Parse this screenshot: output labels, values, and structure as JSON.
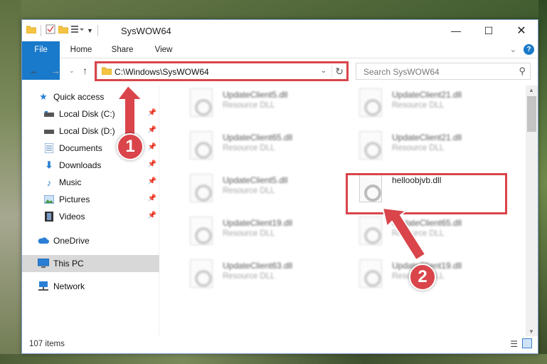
{
  "window": {
    "title": "SysWOW64",
    "controls": {
      "minimize": "—",
      "maximize": "☐",
      "close": "✕"
    }
  },
  "ribbon": {
    "tabs": [
      "File",
      "Home",
      "Share",
      "View"
    ]
  },
  "address": {
    "path": "C:\\Windows\\SysWOW64",
    "search_placeholder": "Search SysWOW64"
  },
  "sidebar": {
    "items": [
      {
        "label": "Quick access",
        "icon": "star-icon",
        "pinned": false
      },
      {
        "label": "Local Disk (C:)",
        "icon": "drive-icon",
        "pinned": true
      },
      {
        "label": "Local Disk (D:)",
        "icon": "drive-icon",
        "pinned": true
      },
      {
        "label": "Documents",
        "icon": "documents-icon",
        "pinned": true
      },
      {
        "label": "Downloads",
        "icon": "download-icon",
        "pinned": true
      },
      {
        "label": "Music",
        "icon": "music-icon",
        "pinned": true
      },
      {
        "label": "Pictures",
        "icon": "pictures-icon",
        "pinned": true
      },
      {
        "label": "Videos",
        "icon": "videos-icon",
        "pinned": true
      },
      {
        "label": "OneDrive",
        "icon": "cloud-icon",
        "pinned": false
      },
      {
        "label": "This PC",
        "icon": "computer-icon",
        "pinned": false,
        "selected": true
      },
      {
        "label": "Network",
        "icon": "network-icon",
        "pinned": false
      }
    ]
  },
  "files": [
    {
      "name": "UpdateClient5.dll",
      "type": "Resource DLL",
      "blurred": true
    },
    {
      "name": "UpdateClient21.dll",
      "type": "Resource DLL",
      "blurred": true
    },
    {
      "name": "UpdateClient65.dll",
      "type": "Resource DLL",
      "blurred": true
    },
    {
      "name": "UpdateClient21.dll",
      "type": "Resource DLL",
      "blurred": true
    },
    {
      "name": "UpdateClient5.dll",
      "type": "Resource DLL",
      "blurred": true
    },
    {
      "name": "helloobjvb.dll",
      "type": "",
      "blurred": false
    },
    {
      "name": "UpdateClient19.dll",
      "type": "Resource DLL",
      "blurred": true
    },
    {
      "name": "UpdateClient65.dll",
      "type": "Resource DLL",
      "blurred": true
    },
    {
      "name": "UpdateClient63.dll",
      "type": "Resource DLL",
      "blurred": true
    },
    {
      "name": "UpdateClient19.dll",
      "type": "Resource DLL",
      "blurred": true
    }
  ],
  "status": {
    "item_count": "107 items"
  },
  "annotations": {
    "step1": "1",
    "step2": "2",
    "color": "#d9454a"
  }
}
